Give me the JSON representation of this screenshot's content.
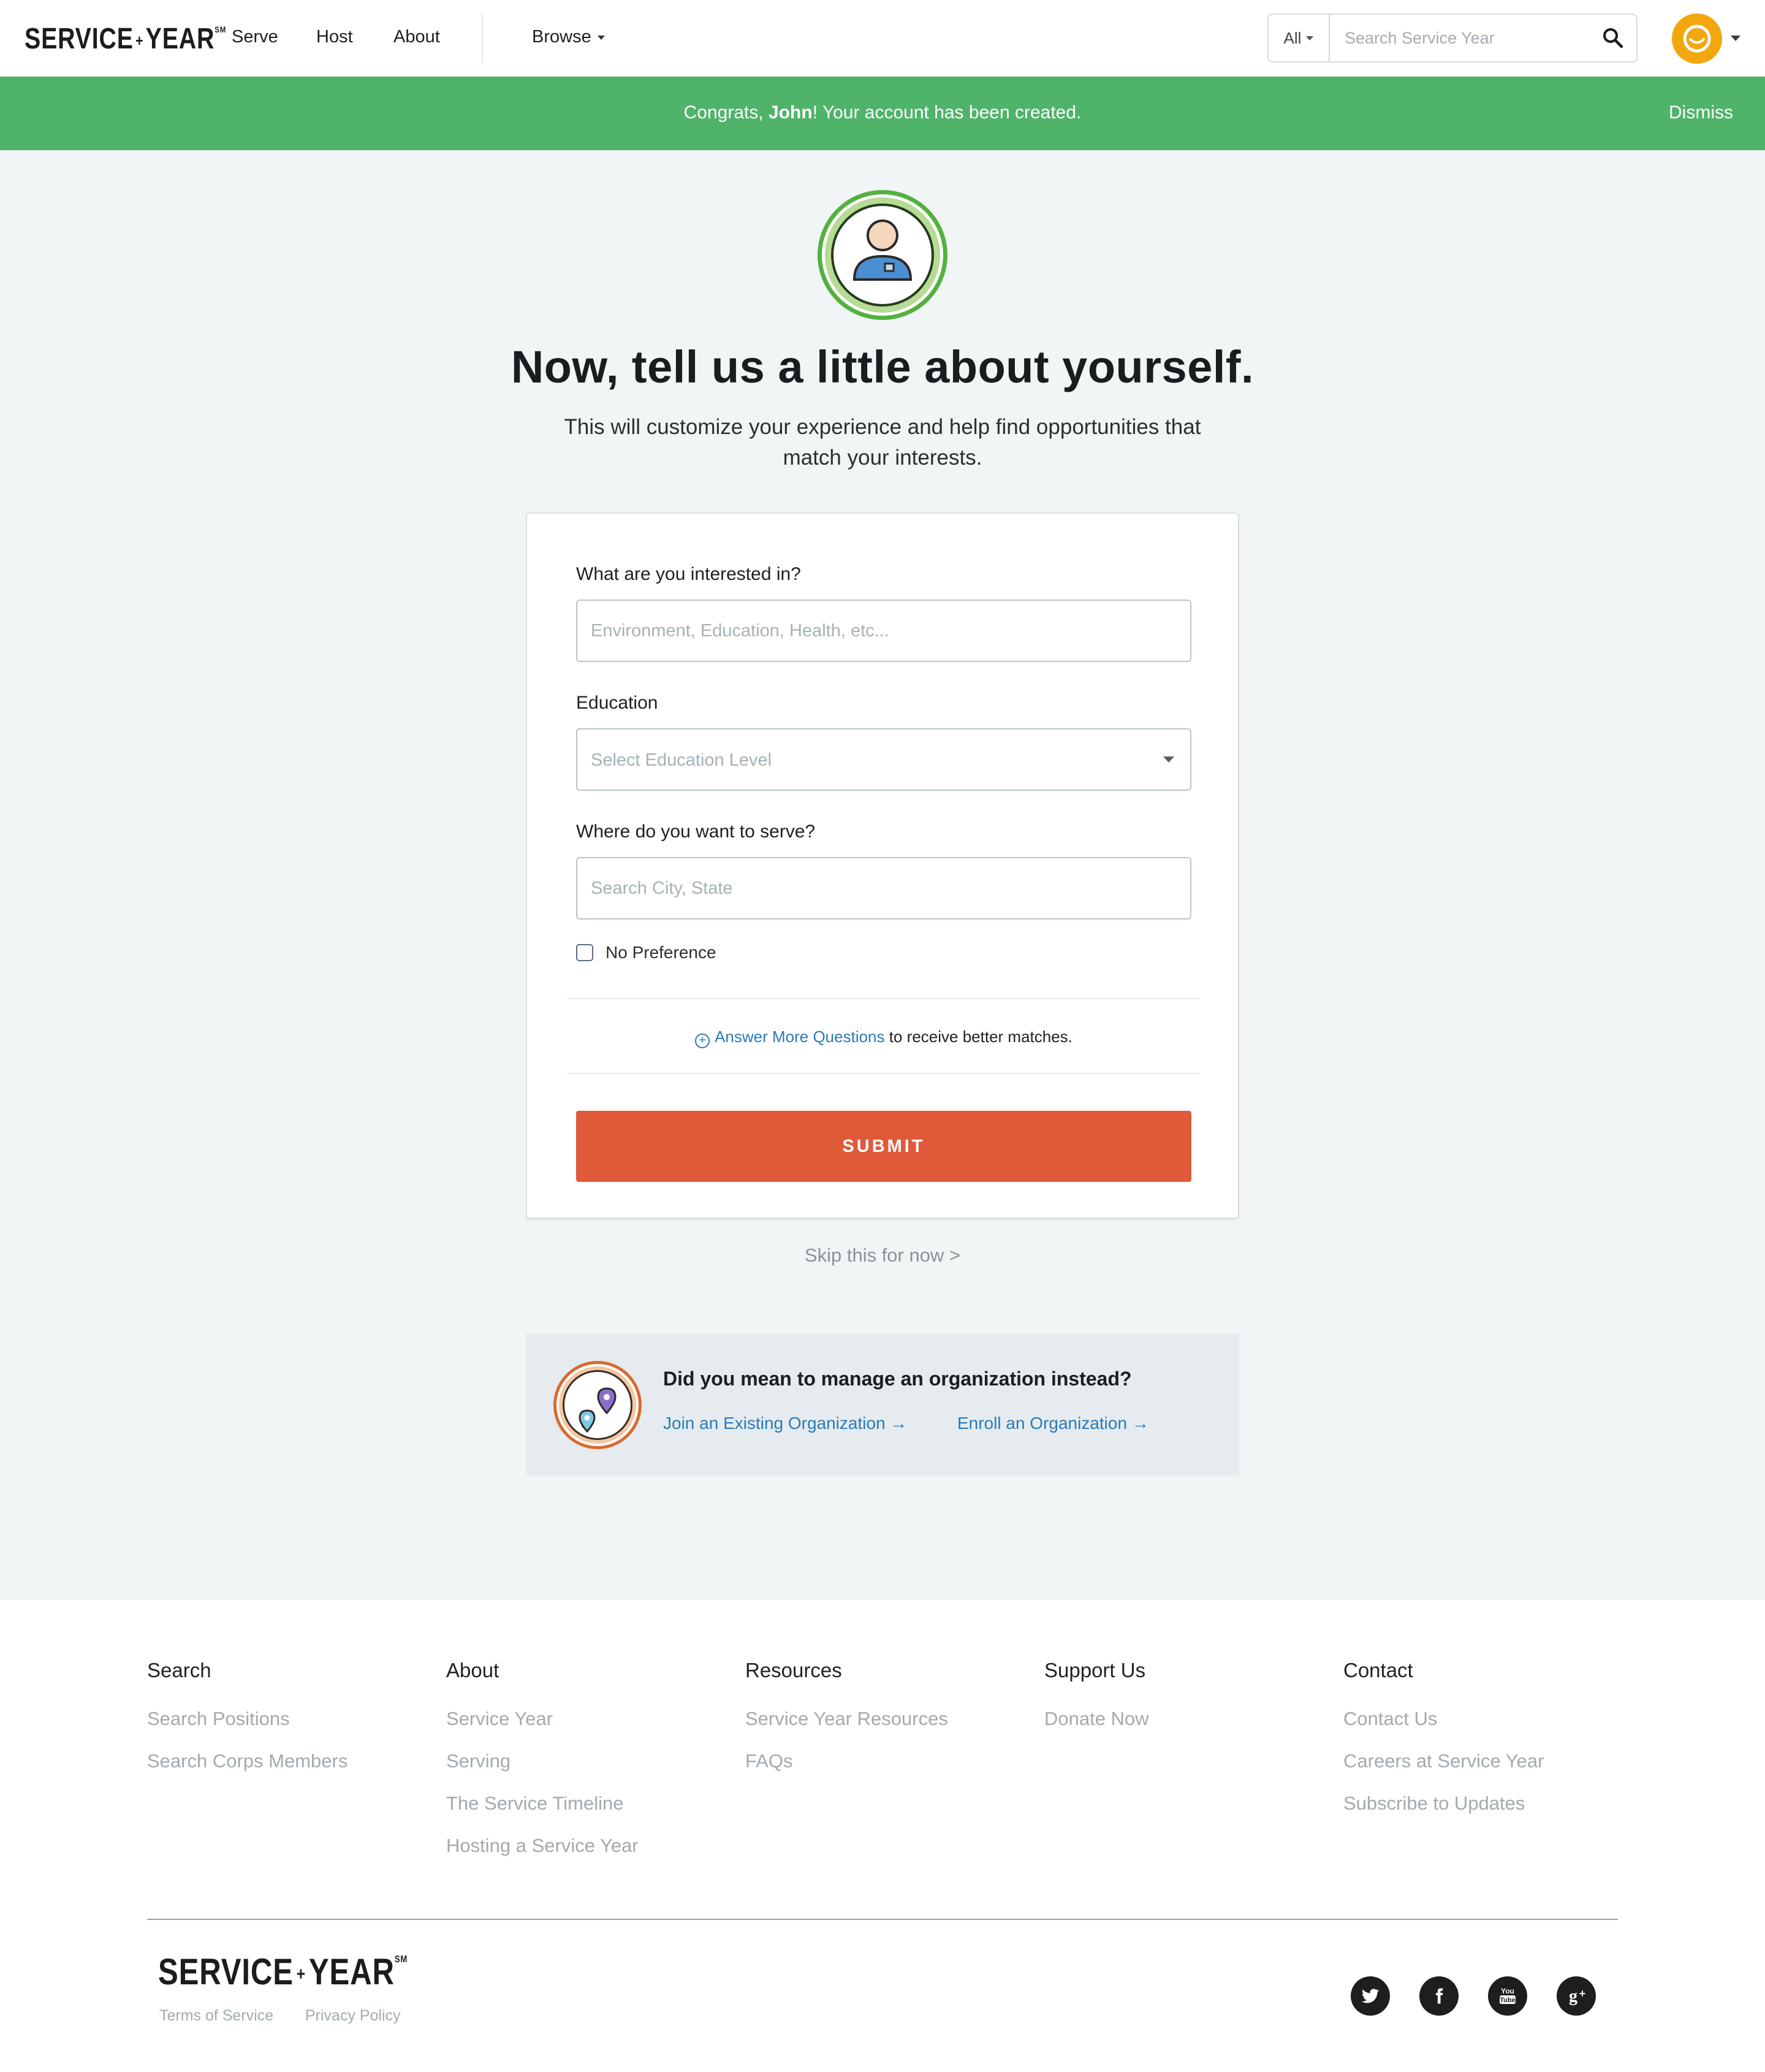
{
  "header": {
    "logo": "SERVICE",
    "logo_sep": "+",
    "logo_end": "YEAR",
    "logo_mark": "SM",
    "nav": [
      "Serve",
      "Host",
      "About"
    ],
    "browse": "Browse",
    "search_scope": "All",
    "search_placeholder": "Search Service Year"
  },
  "banner": {
    "prefix": "Congrats, ",
    "name": "John",
    "suffix": "! Your account has been created.",
    "dismiss": "Dismiss"
  },
  "hero": {
    "title": "Now, tell us a little about yourself.",
    "subtitle": "This will customize your experience and help find opportunities that match your interests."
  },
  "form": {
    "interest_label": "What are you interested in?",
    "interest_placeholder": "Environment, Education, Health, etc...",
    "education_label": "Education",
    "education_value": "Select Education Level",
    "location_label": "Where do you want to serve?",
    "location_placeholder": "Search City, State",
    "no_preference": "No Preference",
    "more_link": "Answer More Questions",
    "more_suffix": " to receive better matches.",
    "submit": "SUBMIT"
  },
  "skip": "Skip this for now >",
  "org": {
    "question": "Did you mean to manage an organization instead?",
    "join": "Join an Existing Organization →",
    "enroll": "Enroll an Organization →"
  },
  "footer": {
    "columns": [
      {
        "title": "Search",
        "links": [
          "Search Positions",
          "Search Corps Members"
        ]
      },
      {
        "title": "About",
        "links": [
          "Service Year",
          "Serving",
          "The Service Timeline",
          "Hosting a Service Year"
        ]
      },
      {
        "title": "Resources",
        "links": [
          "Service Year Resources",
          "FAQs"
        ]
      },
      {
        "title": "Support Us",
        "links": [
          "Donate Now"
        ]
      },
      {
        "title": "Contact",
        "links": [
          "Contact Us",
          "Careers at Service Year",
          "Subscribe to Updates"
        ]
      }
    ],
    "terms": "Terms of Service",
    "privacy": "Privacy Policy",
    "social": [
      "twitter-icon",
      "facebook-icon",
      "youtube-icon",
      "google-plus-icon"
    ]
  },
  "colors": {
    "banner": "#50b36a",
    "submit": "#e05a3a",
    "link": "#2b7ab8",
    "avatar": "#f2a70e"
  }
}
